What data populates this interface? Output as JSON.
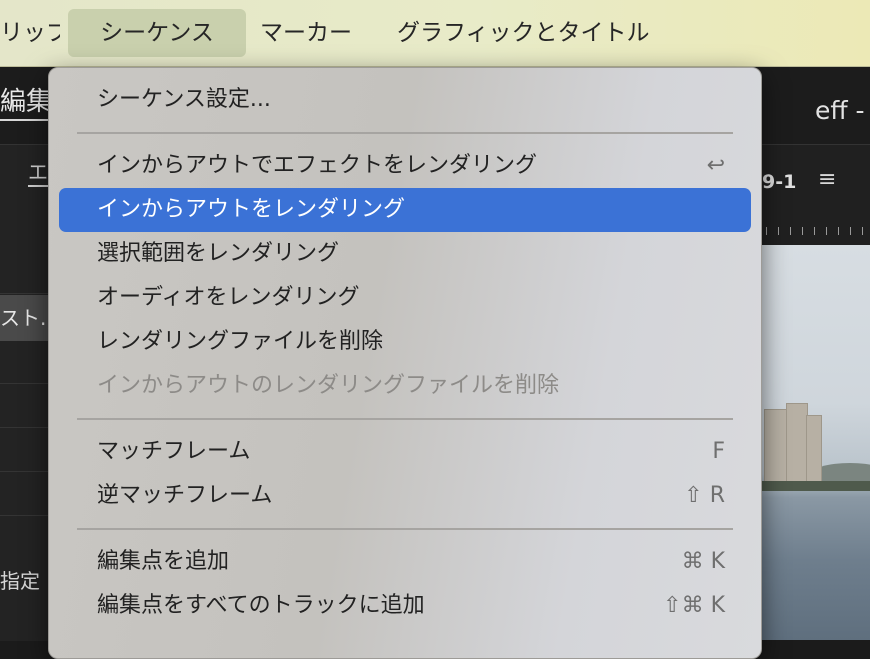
{
  "menubar": {
    "items": [
      {
        "label": "リップ",
        "active": false
      },
      {
        "label": "シーケンス",
        "active": true
      },
      {
        "label": "マーカー",
        "active": false
      },
      {
        "label": "グラフィックとタイトル",
        "active": false
      }
    ]
  },
  "app": {
    "workspace_tab": "編集",
    "title_right": "eff - 編",
    "left_panel_tab": "エ",
    "left_panel_selected": "スト..",
    "left_panel_label": "指定",
    "sequence_label": "9-1",
    "menu_icon": "hamburger-icon"
  },
  "sequence_menu": {
    "items": [
      {
        "label": "シーケンス設定...",
        "shortcut": "",
        "disabled": false,
        "highlighted": false
      },
      {
        "separator": true
      },
      {
        "label": "インからアウトでエフェクトをレンダリング",
        "shortcut": "↩",
        "disabled": false,
        "highlighted": false
      },
      {
        "label": "インからアウトをレンダリング",
        "shortcut": "",
        "disabled": false,
        "highlighted": true
      },
      {
        "label": "選択範囲をレンダリング",
        "shortcut": "",
        "disabled": false,
        "highlighted": false
      },
      {
        "label": "オーディオをレンダリング",
        "shortcut": "",
        "disabled": false,
        "highlighted": false
      },
      {
        "label": "レンダリングファイルを削除",
        "shortcut": "",
        "disabled": false,
        "highlighted": false
      },
      {
        "label": "インからアウトのレンダリングファイルを削除",
        "shortcut": "",
        "disabled": true,
        "highlighted": false
      },
      {
        "separator": true
      },
      {
        "label": "マッチフレーム",
        "shortcut": "F",
        "disabled": false,
        "highlighted": false
      },
      {
        "label": "逆マッチフレーム",
        "shortcut": "⇧ R",
        "disabled": false,
        "highlighted": false
      },
      {
        "separator": true
      },
      {
        "label": "編集点を追加",
        "shortcut": "⌘ K",
        "disabled": false,
        "highlighted": false
      },
      {
        "label": "編集点をすべてのトラックに追加",
        "shortcut": "⇧⌘ K",
        "disabled": false,
        "highlighted": false
      }
    ]
  },
  "colors": {
    "highlight": "#3b72d6",
    "menubar_bg": "#e6e9c8",
    "active_menu_bg": "#c9d0ad"
  }
}
